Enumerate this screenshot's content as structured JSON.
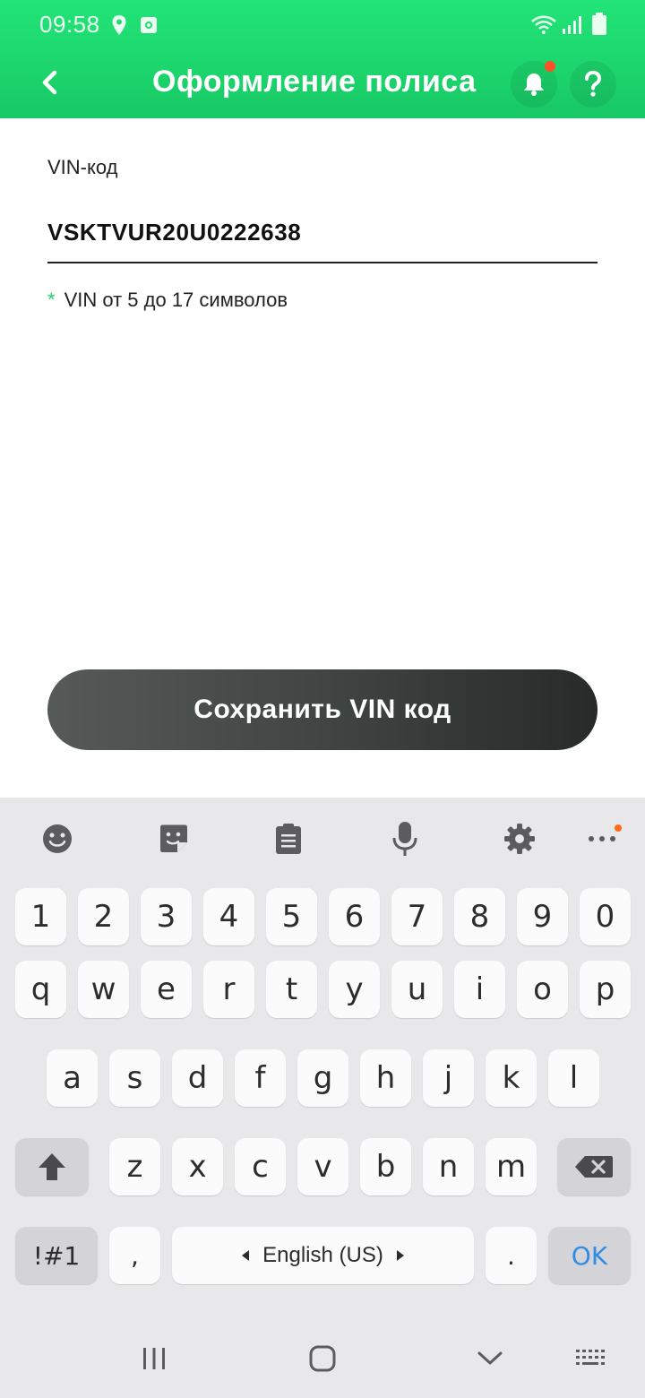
{
  "status_bar": {
    "time": "09:58"
  },
  "header": {
    "title": "Оформление полиса"
  },
  "form": {
    "vin_label": "VIN-код",
    "vin_value": "VSKTVUR20U0222638",
    "hint_asterisk": "*",
    "hint_text": "VIN от 5 до 17 символов"
  },
  "save_button": {
    "label": "Сохранить VIN код"
  },
  "colors": {
    "accent": "#1fdc72",
    "notification_dot": "#ff4f24",
    "button_dark": "#3e4342",
    "ok_key": "#2f8de4"
  },
  "keyboard": {
    "toolbar_icons": [
      "emoji-icon",
      "sticker-icon",
      "clipboard-icon",
      "microphone-icon",
      "settings-icon",
      "more-icon"
    ],
    "row_numbers": [
      "1",
      "2",
      "3",
      "4",
      "5",
      "6",
      "7",
      "8",
      "9",
      "0"
    ],
    "row_top": [
      "q",
      "w",
      "e",
      "r",
      "t",
      "y",
      "u",
      "i",
      "o",
      "p"
    ],
    "row_middle": [
      "a",
      "s",
      "d",
      "f",
      "g",
      "h",
      "j",
      "k",
      "l"
    ],
    "row_bottom": [
      "z",
      "x",
      "c",
      "v",
      "b",
      "n",
      "m"
    ],
    "symbols_key": "!#1",
    "comma_key": ",",
    "space_label": "English (US)",
    "period_key": ".",
    "ok_key": "OK"
  }
}
